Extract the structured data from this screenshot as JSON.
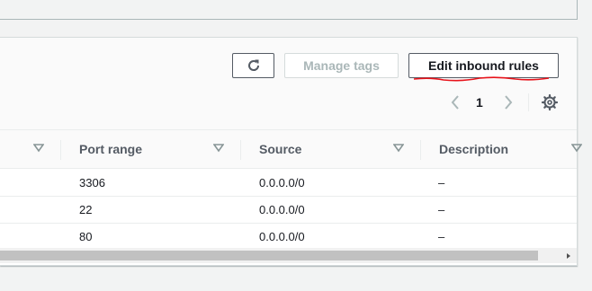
{
  "toolbar": {
    "refresh_icon": "refresh-icon",
    "manage_tags_label": "Manage tags",
    "edit_inbound_rules_label": "Edit inbound rules",
    "annotation_color": "#e8131b"
  },
  "pagination": {
    "current_page": "1",
    "prev_icon": "chevron-left-icon",
    "next_icon": "chevron-right-icon",
    "settings_icon": "gear-icon"
  },
  "table": {
    "columns": [
      {
        "label": ""
      },
      {
        "label": "Port range"
      },
      {
        "label": "Source"
      },
      {
        "label": "Description"
      }
    ],
    "rows": [
      {
        "port_range": "3306",
        "source": "0.0.0.0/0",
        "description": "–"
      },
      {
        "port_range": "22",
        "source": "0.0.0.0/0",
        "description": "–"
      },
      {
        "port_range": "80",
        "source": "0.0.0.0/0",
        "description": "–"
      }
    ]
  },
  "colors": {
    "primary_text": "#16191f",
    "secondary_text": "#545b64",
    "disabled_text": "#aab7b8"
  }
}
